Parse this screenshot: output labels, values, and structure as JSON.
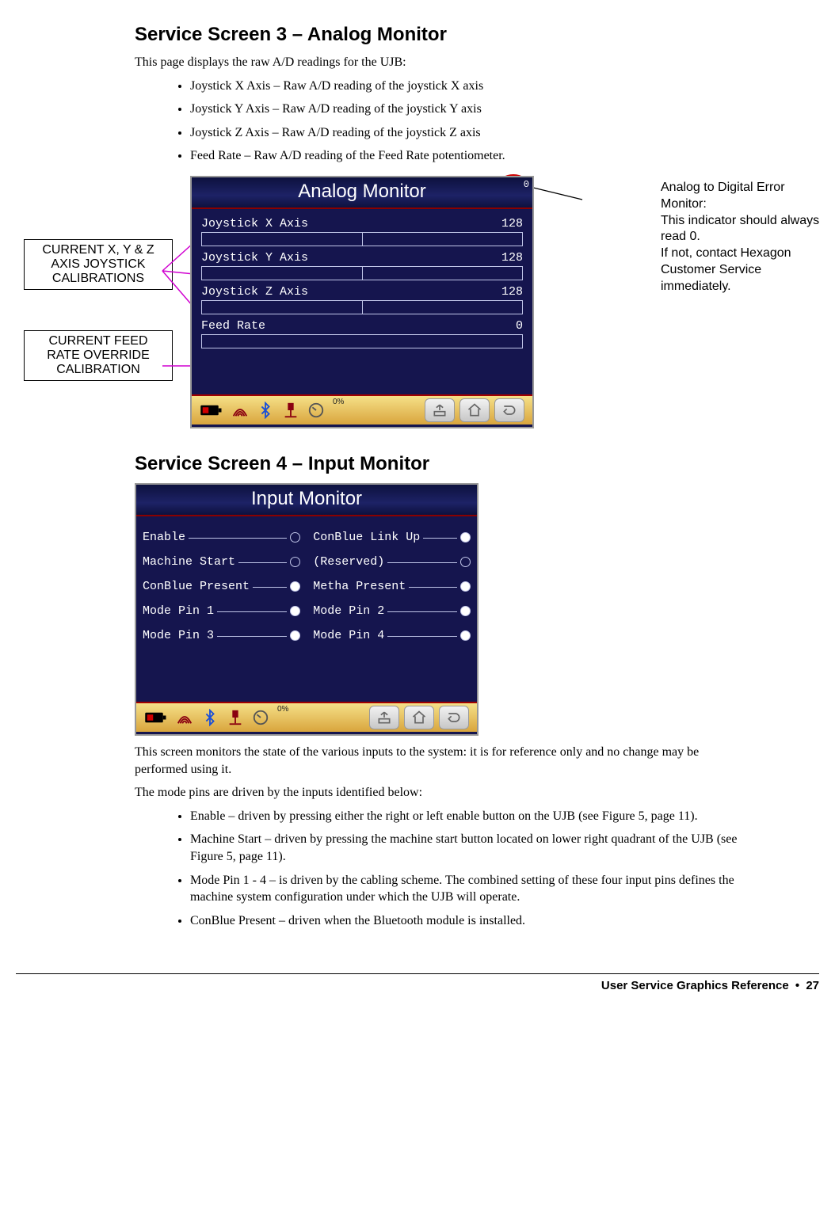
{
  "section1": {
    "heading": "Service Screen 3 – Analog Monitor",
    "intro": "This page displays the raw A/D readings for the UJB:",
    "bullets": [
      "Joystick X Axis – Raw A/D reading of the joystick X axis",
      "Joystick Y Axis – Raw A/D reading of the joystick Y axis",
      "Joystick Z Axis – Raw A/D reading of the joystick Z axis",
      "Feed Rate – Raw A/D reading of the Feed Rate potentiometer."
    ],
    "callout_joystick": "CURRENT X, Y & Z AXIS JOYSTICK CALIBRATIONS",
    "callout_feedrate": "CURRENT FEED RATE OVERRIDE CALIBRATION",
    "side_note": "Analog to Digital Error Monitor:\nThis indicator should always read 0.\nIf not, contact Hexagon Customer Service immediately."
  },
  "analog_screen": {
    "title": "Analog Monitor",
    "corner_value": "0",
    "rows": [
      {
        "label": "Joystick X Axis",
        "value": "128"
      },
      {
        "label": "Joystick Y Axis",
        "value": "128"
      },
      {
        "label": "Joystick Z Axis",
        "value": "128"
      },
      {
        "label": "Feed Rate",
        "value": "0"
      }
    ],
    "pct_label": "0%"
  },
  "section2": {
    "heading": "Service Screen 4 – Input Monitor",
    "post1": "This screen monitors the state of the various inputs to the system: it is for reference only and no change may be performed using it.",
    "post2": "The mode pins are driven by the inputs identified below:",
    "bullets": [
      "Enable – driven by pressing either the right or left enable button on the UJB (see Figure 5, page 11).",
      "Machine Start – driven by pressing the machine start button located on lower right quadrant of the UJB (see Figure 5, page 11).",
      "Mode Pin 1 - 4 – is driven by the cabling scheme.  The combined setting of these four input pins defines the machine system configuration under which the UJB will operate.",
      "ConBlue Present – driven when the Bluetooth module is installed."
    ]
  },
  "input_screen": {
    "title": "Input Monitor",
    "rows": [
      [
        {
          "label": "Enable",
          "on": false
        },
        {
          "label": "ConBlue Link Up",
          "on": true
        }
      ],
      [
        {
          "label": "Machine Start",
          "on": false
        },
        {
          "label": "(Reserved)",
          "on": false
        }
      ],
      [
        {
          "label": "ConBlue Present",
          "on": true
        },
        {
          "label": "Metha Present",
          "on": true
        }
      ],
      [
        {
          "label": "Mode Pin 1",
          "on": true
        },
        {
          "label": "Mode Pin 2",
          "on": true
        }
      ],
      [
        {
          "label": "Mode Pin 3",
          "on": true
        },
        {
          "label": "Mode Pin 4",
          "on": true
        }
      ]
    ],
    "pct_label": "0%"
  },
  "footer": {
    "title": "User Service Graphics Reference",
    "page": "27"
  }
}
